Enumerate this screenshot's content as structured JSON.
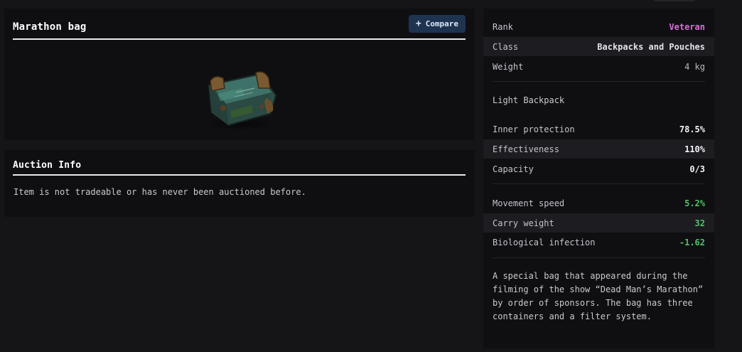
{
  "item": {
    "name": "Marathon bag",
    "compare_label": "Compare",
    "image_name": "marathon-bag-image"
  },
  "auction": {
    "title": "Auction Info",
    "message": "Item is not tradeable or has never been auctioned before."
  },
  "stats": {
    "rank": {
      "label": "Rank",
      "value": "Veteran"
    },
    "class": {
      "label": "Class",
      "value": "Backpacks and Pouches"
    },
    "weight": {
      "label": "Weight",
      "value": "4 kg"
    },
    "type_label": "Light Backpack",
    "inner_protection": {
      "label": "Inner protection",
      "value": "78.5%"
    },
    "effectiveness": {
      "label": "Effectiveness",
      "value": "110%"
    },
    "capacity": {
      "label": "Capacity",
      "value": "0/3"
    },
    "movement_speed": {
      "label": "Movement speed",
      "value": "5.2%"
    },
    "carry_weight": {
      "label": "Carry weight",
      "value": "32"
    },
    "bio_infection": {
      "label": "Biological infection",
      "value": "-1.62"
    },
    "description": "A special bag that appeared during the filming of the show “Dead Man’s Marathon” by order of sponsors. The bag has three containers and a filter system."
  },
  "colors": {
    "rank_veteran": "#d96fd8",
    "positive": "#52c06a",
    "button_bg": "#1e3350"
  }
}
